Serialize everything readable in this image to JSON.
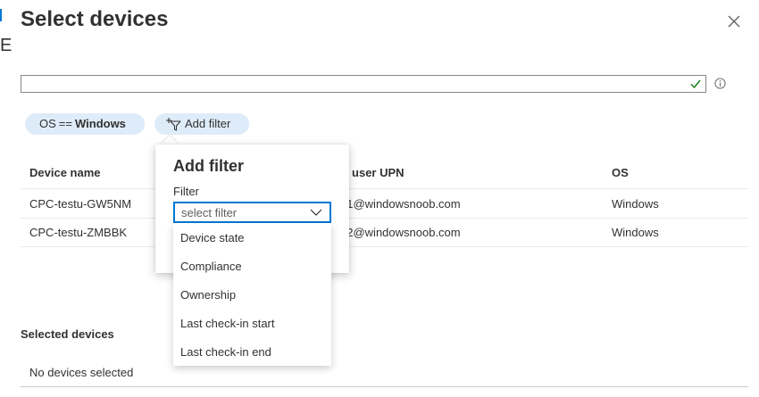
{
  "edge": {
    "mark": "E"
  },
  "panel": {
    "title": "Select devices",
    "close_icon": "close-icon"
  },
  "search": {
    "value": "",
    "placeholder": "",
    "valid_icon": "checkmark-icon",
    "info_icon": "info-icon"
  },
  "filters": {
    "active": {
      "field": "OS",
      "operator": "==",
      "value": "Windows"
    },
    "add_label": "Add filter",
    "add_icon": "add-filter-icon"
  },
  "table": {
    "columns": [
      "Device name",
      "Primary user UPN",
      "OS"
    ],
    "rows": [
      {
        "device": "CPC-testu-GW5NM",
        "upn": "testuser1@windowsnoob.com",
        "os": "Windows"
      },
      {
        "device": "CPC-testu-ZMBBK",
        "upn": "testuser2@windowsnoob.com",
        "os": "Windows"
      }
    ]
  },
  "add_filter_popup": {
    "title": "Add filter",
    "field_label": "Filter",
    "select_placeholder": "select filter",
    "options": [
      "Device state",
      "Compliance",
      "Ownership",
      "Last check-in start",
      "Last check-in end"
    ]
  },
  "selected": {
    "title": "Selected devices",
    "empty_text": "No devices selected"
  },
  "colors": {
    "accent": "#0078d4",
    "pill_bg": "#deecf9",
    "valid": "#107c10"
  }
}
